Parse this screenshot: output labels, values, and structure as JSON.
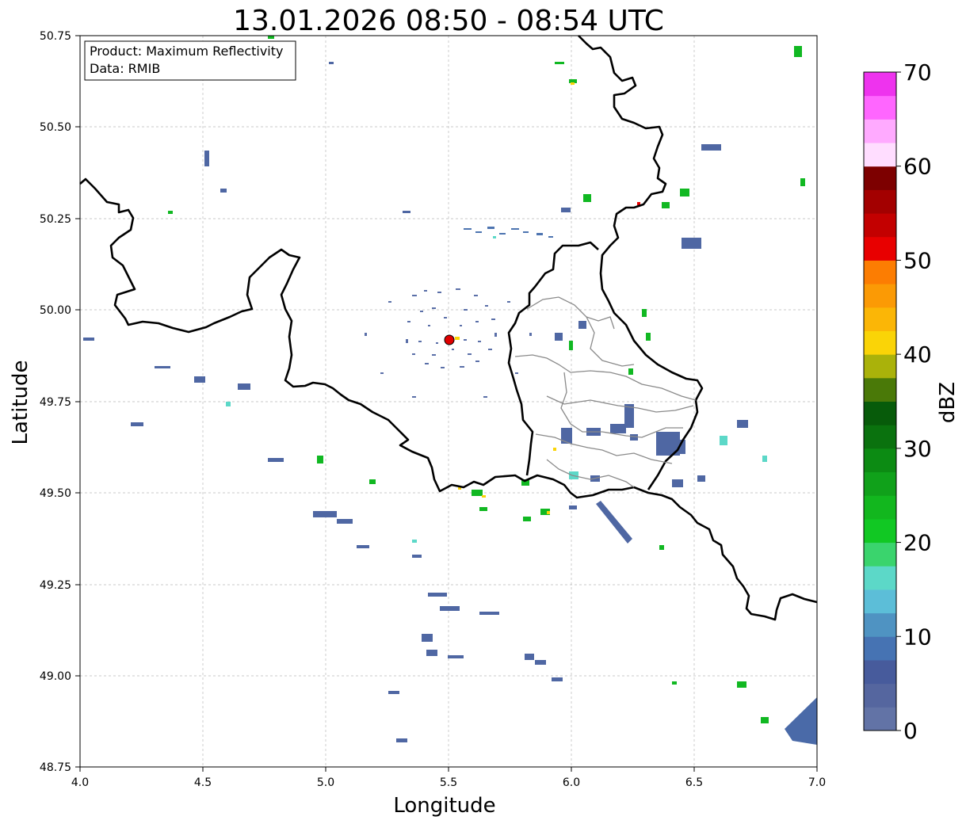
{
  "title": "13.01.2026 08:50 - 08:54 UTC",
  "info_box": {
    "line1": "Product: Maximum Reflectivity",
    "line2": "Data: RMIB"
  },
  "axes": {
    "xlabel": "Longitude",
    "ylabel": "Latitude",
    "xlim": [
      4.0,
      7.0
    ],
    "ylim": [
      48.75,
      50.75
    ],
    "x_ticks": [
      "4.0",
      "4.5",
      "5.0",
      "5.5",
      "6.0",
      "6.5",
      "7.0"
    ],
    "y_ticks": [
      "48.75",
      "49.00",
      "49.25",
      "49.50",
      "49.75",
      "50.00",
      "50.25",
      "50.50",
      "50.75"
    ],
    "grid": true
  },
  "radar_site": {
    "lon": 5.505,
    "lat": 49.915,
    "color": "#e00000"
  },
  "colorbar": {
    "label": "dBZ",
    "range": [
      0,
      70
    ],
    "tick_labels": [
      "0",
      "10",
      "20",
      "30",
      "40",
      "50",
      "60",
      "70"
    ],
    "colors": [
      "#6273a6",
      "#55669f",
      "#475b9c",
      "#4673b3",
      "#4f93c2",
      "#5cbed8",
      "#5cd8c8",
      "#3ad46d",
      "#11c823",
      "#12b71e",
      "#10a11a",
      "#0c8b13",
      "#0a720e",
      "#075b0a",
      "#4a7908",
      "#aab20a",
      "#fad407",
      "#fbb606",
      "#fb9a05",
      "#fc7d02",
      "#e80000",
      "#c30000",
      "#a30000",
      "#7d0000",
      "#ffddff",
      "#ffaaff",
      "#ff66ff",
      "#ee33ee"
    ]
  },
  "map_colors": {
    "border": "#000000",
    "province_lines": "#808080"
  }
}
